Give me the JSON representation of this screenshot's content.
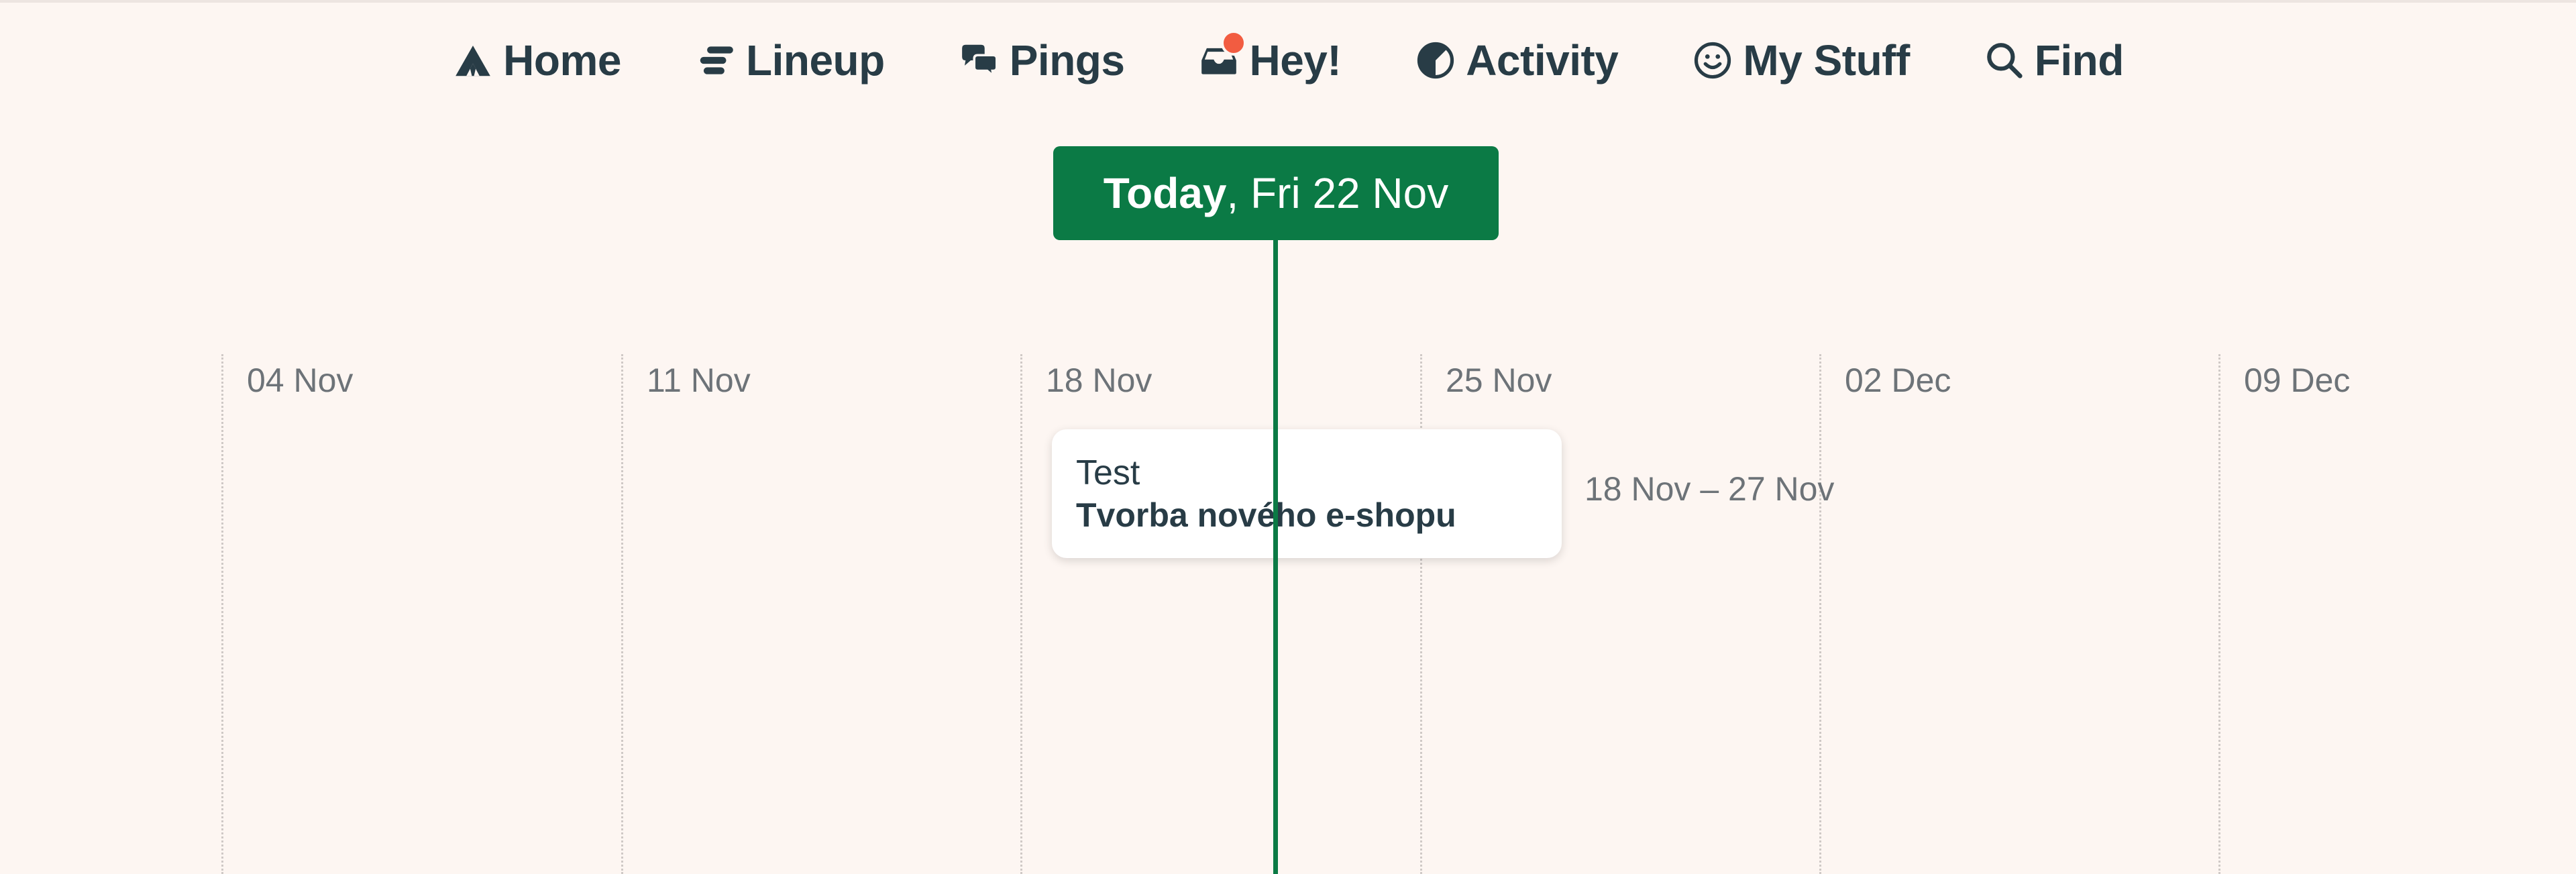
{
  "nav": {
    "items": [
      {
        "label": "Home",
        "icon": "home-icon"
      },
      {
        "label": "Lineup",
        "icon": "lineup-icon"
      },
      {
        "label": "Pings",
        "icon": "pings-icon"
      },
      {
        "label": "Hey!",
        "icon": "hey-inbox-icon"
      },
      {
        "label": "Activity",
        "icon": "activity-icon"
      },
      {
        "label": "My Stuff",
        "icon": "smiley-icon"
      },
      {
        "label": "Find",
        "icon": "search-icon"
      }
    ]
  },
  "today": {
    "strong": "Today",
    "date": ", Fri 22 Nov"
  },
  "timeline": {
    "weeks": [
      "04 Nov",
      "11 Nov",
      "18 Nov",
      "25 Nov",
      "02 Dec",
      "09 Dec"
    ]
  },
  "event": {
    "title": "Test",
    "project": "Tvorba nového e-shopu",
    "range": "18 Nov – 27 Nov"
  },
  "colors": {
    "background": "#fdf6f2",
    "accent": "#0b7a45",
    "notification": "#f25c41",
    "text": "#283c46",
    "muted": "#6d7378"
  }
}
